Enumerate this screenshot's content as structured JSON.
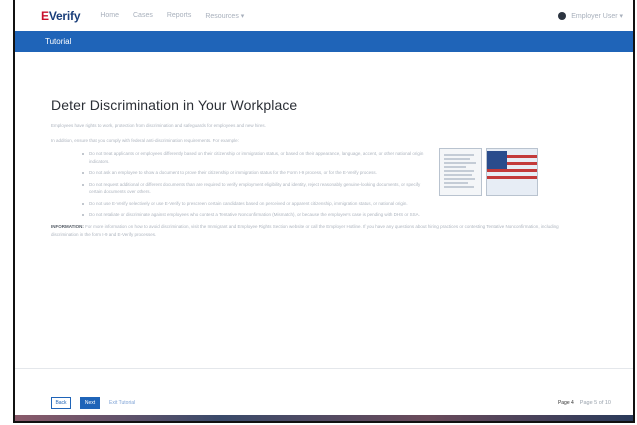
{
  "app": {
    "logo_prefix": "E",
    "logo_rest": "Verify"
  },
  "nav": {
    "items": [
      "Home",
      "Cases",
      "Reports",
      "Resources ▾"
    ]
  },
  "user": {
    "label": "Employer User ▾"
  },
  "tab_bar": {
    "label": "Tutorial"
  },
  "page": {
    "title": "Deter Discrimination in Your Workplace",
    "intro": "Employees have rights to work, protection from discrimination and safeguards for employees and new hires.",
    "requirement": "In addition, ensure that you comply with federal anti-discrimination requirements. For example:",
    "bullets": [
      "Do not treat applicants or employees differently based on their citizenship or immigration status, or based on their appearance, language, accent, or other national origin indicators.",
      "Do not ask an employee to show a document to prove their citizenship or immigration status for the Form I-9 process, or for the E-Verify process.",
      "Do not request additional or different documents than are required to verify employment eligibility and identity, reject reasonably genuine-looking documents, or specify certain documents over others.",
      "Do not use E-Verify selectively or use E-Verify to prescreen certain candidates based on perceived or apparent citizenship, immigration status, or national origin.",
      "Do not retaliate or discriminate against employees who contest a Tentative Nonconfirmation (Mismatch), or because the employee's case is pending with DHS or SSA."
    ],
    "info_label": "INFORMATION:",
    "info_text": " For more information on how to avoid discrimination, visit the Immigrant and Employee Rights Section website or call the Employer Hotline. If you have any questions about hiring practices or contesting Tentative Nonconfirmation, including discrimination in the form I-9 and E-Verify processes."
  },
  "footer": {
    "back_label": "Back",
    "next_label": "Next",
    "exit_label": "Exit Tutorial",
    "page_current": "Page 4",
    "page_rest": "Page 5 of 10"
  },
  "colors": {
    "brand_blue": "#1f64b8",
    "logo_red": "#c8102e"
  }
}
